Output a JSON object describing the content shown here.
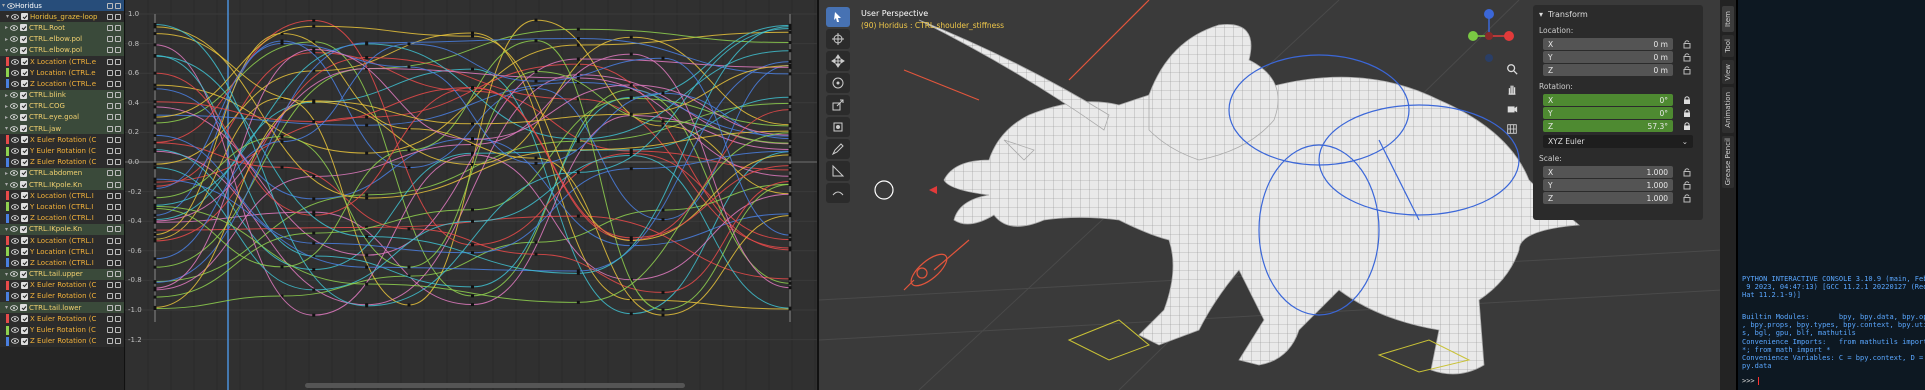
{
  "channels": [
    {
      "label": "Horidus",
      "kind": "root",
      "expanded": true
    },
    {
      "label": "Horidus_graze-loop",
      "kind": "action",
      "expanded": true
    },
    {
      "label": "CTRL.Root",
      "kind": "group",
      "expanded": false
    },
    {
      "label": "CTRL.elbow.pol",
      "kind": "group",
      "expanded": false
    },
    {
      "label": "CTRL.elbow.pol",
      "kind": "group",
      "expanded": true
    },
    {
      "label": "X Location (CTRL.e",
      "kind": "fcurve",
      "color": "#e74a4a"
    },
    {
      "label": "Y Location (CTRL.e",
      "kind": "fcurve",
      "color": "#8fd14f"
    },
    {
      "label": "Z Location (CTRL.e",
      "kind": "fcurve",
      "color": "#4a7fe0"
    },
    {
      "label": "CTRL.blink",
      "kind": "group",
      "expanded": false
    },
    {
      "label": "CTRL.COG",
      "kind": "group",
      "expanded": false
    },
    {
      "label": "CTRL.eye.goal",
      "kind": "group",
      "expanded": false
    },
    {
      "label": "CTRL.jaw",
      "kind": "group",
      "expanded": true
    },
    {
      "label": "X Euler Rotation (C",
      "kind": "fcurve",
      "color": "#e74a4a"
    },
    {
      "label": "Y Euler Rotation (C",
      "kind": "fcurve",
      "color": "#8fd14f"
    },
    {
      "label": "Z Euler Rotation (C",
      "kind": "fcurve",
      "color": "#4a7fe0"
    },
    {
      "label": "CTRL.abdomen",
      "kind": "group",
      "expanded": false
    },
    {
      "label": "CTRL.IKpole.Kn",
      "kind": "group",
      "expanded": true
    },
    {
      "label": "X Location (CTRL.I",
      "kind": "fcurve",
      "color": "#e74a4a"
    },
    {
      "label": "Y Location (CTRL.I",
      "kind": "fcurve",
      "color": "#8fd14f"
    },
    {
      "label": "Z Location (CTRL.I",
      "kind": "fcurve",
      "color": "#4a7fe0"
    },
    {
      "label": "CTRL.IKpole.Kn",
      "kind": "group",
      "expanded": true
    },
    {
      "label": "X Location (CTRL.I",
      "kind": "fcurve",
      "color": "#e74a4a"
    },
    {
      "label": "Y Location (CTRL.I",
      "kind": "fcurve",
      "color": "#8fd14f"
    },
    {
      "label": "Z Location (CTRL.I",
      "kind": "fcurve",
      "color": "#4a7fe0"
    },
    {
      "label": "CTRL.tail.upper",
      "kind": "group",
      "expanded": true
    },
    {
      "label": "X Euler Rotation (C",
      "kind": "fcurve",
      "color": "#e74a4a"
    },
    {
      "label": "Z Euler Rotation (C",
      "kind": "fcurve",
      "color": "#4a7fe0"
    },
    {
      "label": "CTRL.tail.lower",
      "kind": "group",
      "expanded": true
    },
    {
      "label": "X Euler Rotation (C",
      "kind": "fcurve",
      "color": "#e74a4a"
    },
    {
      "label": "Y Euler Rotation (C",
      "kind": "fcurve",
      "color": "#8fd14f"
    },
    {
      "label": "Z Euler Rotation (C",
      "kind": "fcurve",
      "color": "#4a7fe0"
    }
  ],
  "graph": {
    "y_ticks": [
      "1.0",
      "0.8",
      "0.6",
      "0.4",
      "0.2",
      "0.0",
      "-0.2",
      "-0.4",
      "-0.6",
      "-0.8",
      "-1.0",
      "-1.2"
    ],
    "curve_colors": [
      "#e74a4a",
      "#8fd14f",
      "#4a7fe0",
      "#e8c33b",
      "#e07ac0",
      "#3fbfcf"
    ]
  },
  "viewport": {
    "title": "User Perspective",
    "subtitle": "(90) Horidus : CTRL.shoulder_stiffness"
  },
  "npanel": {
    "header": "Transform",
    "location_label": "Location:",
    "location": [
      {
        "axis": "X",
        "value": "0 m"
      },
      {
        "axis": "Y",
        "value": "0 m"
      },
      {
        "axis": "Z",
        "value": "0 m"
      }
    ],
    "rotation_label": "Rotation:",
    "rotation": [
      {
        "axis": "X",
        "value": "0°"
      },
      {
        "axis": "Y",
        "value": "0°"
      },
      {
        "axis": "Z",
        "value": "57.3°"
      }
    ],
    "rotation_mode": "XYZ Euler",
    "scale_label": "Scale:",
    "scale": [
      {
        "axis": "X",
        "value": "1.000"
      },
      {
        "axis": "Y",
        "value": "1.000"
      },
      {
        "axis": "Z",
        "value": "1.000"
      }
    ]
  },
  "sidebar_tabs": [
    "Item",
    "Tool",
    "View",
    "Animation",
    "Grease Pencil"
  ],
  "console": {
    "banner": "PYTHON INTERACTIVE CONSOLE 3.10.9 (main, Feb\n 9 2023, 04:47:13) [GCC 11.2.1 20220127 (Red\nHat 11.2.1-9)]",
    "modules": "Builtin Modules:       bpy, bpy.data, bpy.ops\n, bpy.props, bpy.types, bpy.context, bpy.utils\ns, bgl, gpu, blf, mathutils\nConvenience Imports:   from mathutils import\n*; from math import *\nConvenience Variables: C = bpy.context, D =\npy.data",
    "prompt": ">>>"
  }
}
